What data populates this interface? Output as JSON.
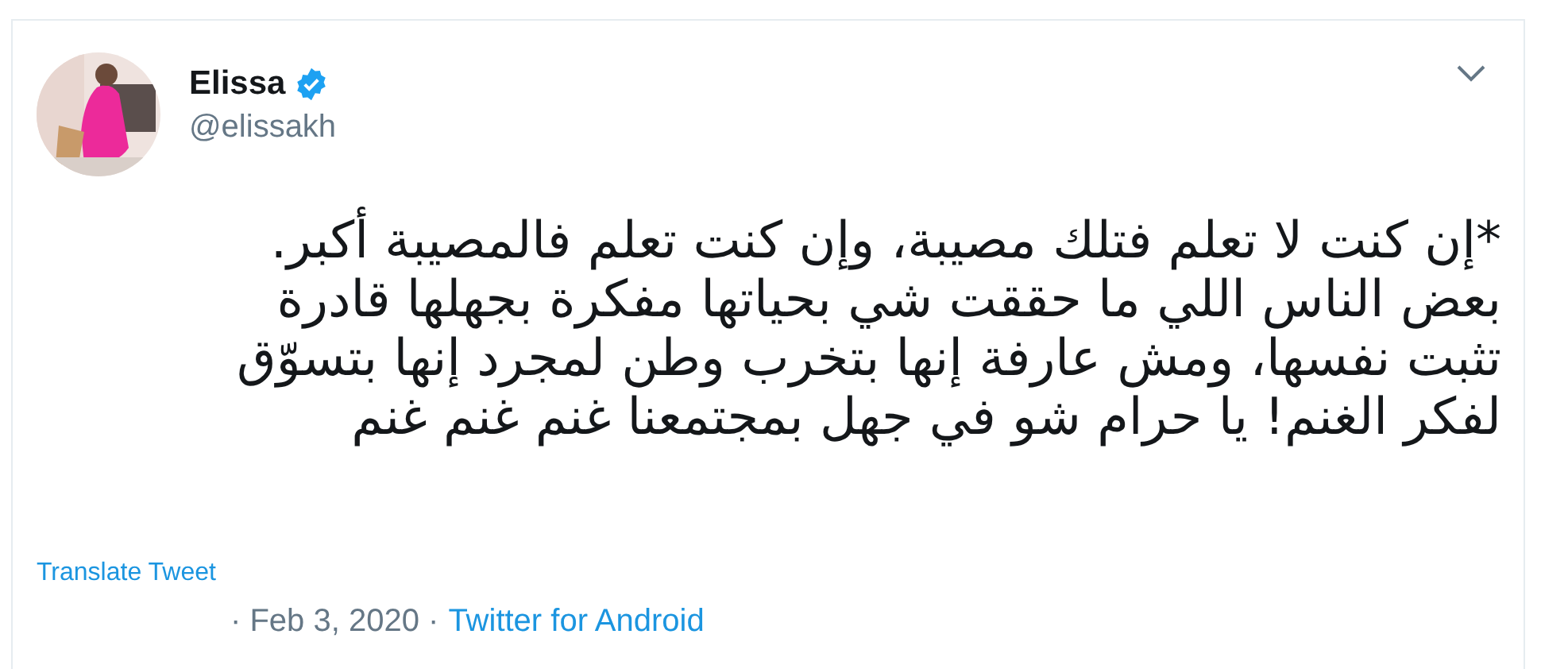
{
  "author": {
    "name": "Elissa",
    "verified": true,
    "handle": "@elissakh"
  },
  "tweet": {
    "text_lines": [
      "*إن كنت لا تعلم فتلك مصيبة، وإن كنت تعلم فالمصيبة أكبر.",
      "بعض الناس اللي ما حققت شي بحياتها مفكرة بجهلها قادرة",
      "تثبت نفسها، ومش عارفة إنها بتخرب وطن لمجرد إنها بتسوّق",
      "لفكر الغنم! يا حرام شو في جهل بمجتمعنا غنم غنم غنم"
    ]
  },
  "translate_link": "Translate Tweet",
  "meta": {
    "date": "· Feb 3, 2020 ·",
    "source": "Twitter for Android"
  }
}
